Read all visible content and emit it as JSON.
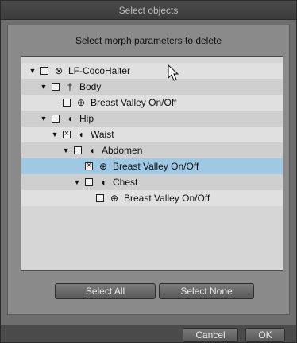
{
  "window": {
    "title": "Select objects"
  },
  "prompt": "Select morph parameters to delete",
  "tree": [
    {
      "label": "LF-CocoHalter",
      "icon": "figure-icon",
      "glyph": "⊗",
      "arrow": "▼",
      "checked": false,
      "selected": false
    },
    {
      "label": "Body",
      "icon": "body-icon",
      "glyph": "†",
      "arrow": "▼",
      "checked": false,
      "selected": false
    },
    {
      "label": "Breast Valley On/Off",
      "icon": "morph-dial-icon",
      "glyph": "⊕",
      "arrow": "",
      "checked": false,
      "selected": false
    },
    {
      "label": "Hip",
      "icon": "bone-icon",
      "glyph": "◖",
      "arrow": "▼",
      "checked": false,
      "selected": false
    },
    {
      "label": "Waist",
      "icon": "bone-icon",
      "glyph": "◖",
      "arrow": "▼",
      "checked": true,
      "selected": false
    },
    {
      "label": "Abdomen",
      "icon": "bone-icon",
      "glyph": "◖",
      "arrow": "▼",
      "checked": false,
      "selected": false
    },
    {
      "label": "Breast Valley On/Off",
      "icon": "morph-dial-icon",
      "glyph": "⊕",
      "arrow": "",
      "checked": true,
      "selected": true
    },
    {
      "label": "Chest",
      "icon": "bone-icon",
      "glyph": "◖",
      "arrow": "▼",
      "checked": false,
      "selected": false
    },
    {
      "label": "Breast Valley On/Off",
      "icon": "morph-dial-icon",
      "glyph": "⊕",
      "arrow": "",
      "checked": false,
      "selected": false
    }
  ],
  "buttons": {
    "select_all": "Select All",
    "select_none": "Select None",
    "cancel": "Cancel",
    "ok": "OK"
  },
  "colors": {
    "selection": "#9ec8e4",
    "dialog_bg": "#6e6e6e",
    "tree_bg": "#d6d6d6"
  }
}
